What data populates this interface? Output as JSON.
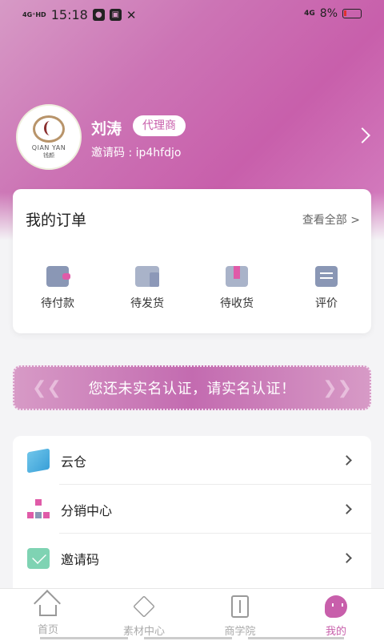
{
  "status_bar": {
    "network": "4G⁺HD",
    "time": "15:18",
    "network_right": "4G",
    "battery": "8%"
  },
  "profile": {
    "avatar_logo_text": "QIAN YAN",
    "avatar_logo_sub": "钱颜",
    "name": "刘涛",
    "role": "代理商",
    "invite_label": "邀请码 :",
    "invite_code": "ip4hfdjo"
  },
  "orders": {
    "title": "我的订单",
    "view_all": "查看全部 >",
    "items": [
      {
        "label": "待付款",
        "icon": "wallet-icon"
      },
      {
        "label": "待发货",
        "icon": "truck-icon"
      },
      {
        "label": "待收货",
        "icon": "package-icon"
      },
      {
        "label": "评价",
        "icon": "comment-icon"
      }
    ]
  },
  "verify_banner": {
    "text": "您还未实名认证，请实名认证！"
  },
  "menu": [
    {
      "label": "云仓",
      "icon": "cloud-warehouse-icon"
    },
    {
      "label": "分销中心",
      "icon": "distribution-icon"
    },
    {
      "label": "邀请码",
      "icon": "invite-icon"
    }
  ],
  "tabs": [
    {
      "label": "首页",
      "icon": "home-icon"
    },
    {
      "label": "素材中心",
      "icon": "layers-icon"
    },
    {
      "label": "商学院",
      "icon": "book-icon"
    },
    {
      "label": "我的",
      "icon": "profile-icon",
      "active": true
    }
  ],
  "colors": {
    "accent": "#c85fab",
    "header_gradient_start": "#d79ac6",
    "header_gradient_end": "#d580c1"
  }
}
